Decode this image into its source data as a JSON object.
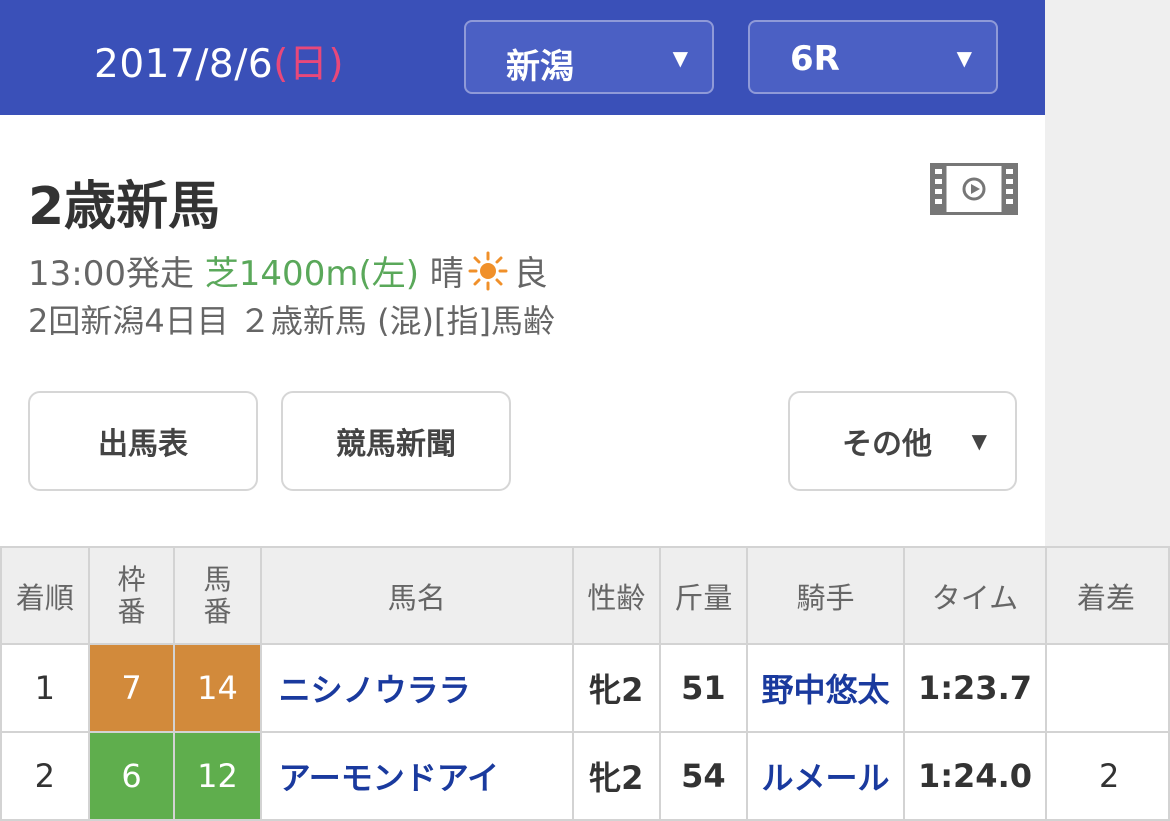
{
  "header": {
    "date": "2017/8/6",
    "weekday": "(日)",
    "venue_select": "新潟",
    "race_select": "6R",
    "select_arrow": "▼"
  },
  "race": {
    "title": "2歳新馬",
    "start_time": "13:00発走",
    "course": "芝1400m(左)",
    "weather": "晴",
    "weather_icon": "sun-icon",
    "track_condition": "良",
    "detail": "2回新潟4日目 ２歳新馬 (混)[指]馬齢"
  },
  "buttons": {
    "shutsuba": "出馬表",
    "shinbun": "競馬新聞",
    "other": "その他",
    "other_arrow": "▼"
  },
  "colors": {
    "header_bg": "#3a50b8",
    "weekday": "#e8487a",
    "course": "#5aa85a",
    "waku7": "#d28a3b",
    "waku6": "#5fae4d",
    "link": "#1a3a9e"
  },
  "table": {
    "headers": {
      "rank": "着順",
      "waku_1": "枠",
      "waku_2": "番",
      "umaban_1": "馬",
      "umaban_2": "番",
      "horse": "馬名",
      "sexage": "性齢",
      "weight": "斤量",
      "jockey": "騎手",
      "time": "タイム",
      "margin": "着差"
    },
    "rows": [
      {
        "rank": "1",
        "waku": "7",
        "umaban": "14",
        "horse": "ニシノウララ",
        "sexage": "牝2",
        "weight": "51",
        "jockey": "野中悠太",
        "time": "1:23.7",
        "margin": ""
      },
      {
        "rank": "2",
        "waku": "6",
        "umaban": "12",
        "horse": "アーモンドアイ",
        "sexage": "牝2",
        "weight": "54",
        "jockey": "ルメール",
        "time": "1:24.0",
        "margin": "2"
      }
    ]
  }
}
